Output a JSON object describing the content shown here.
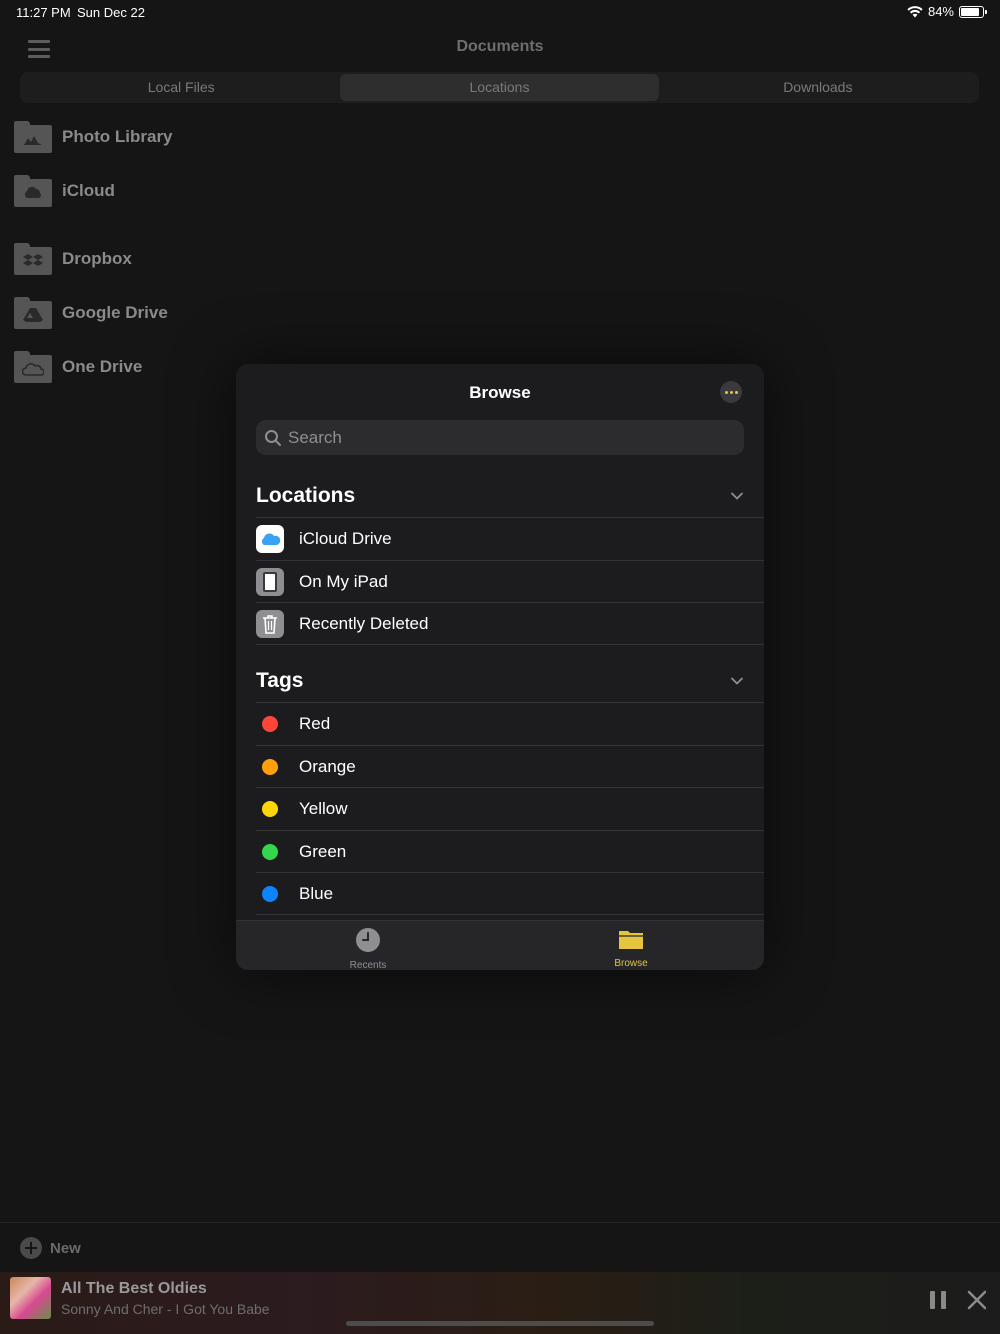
{
  "status_bar": {
    "time": "11:27 PM",
    "date": "Sun Dec 22",
    "battery": "84%",
    "battery_level": 0.84
  },
  "header": {
    "title": "Documents"
  },
  "segments": [
    {
      "label": "Local Files"
    },
    {
      "label": "Locations"
    },
    {
      "label": "Downloads"
    }
  ],
  "locations": [
    {
      "label": "Photo Library",
      "icon": "photo-icon"
    },
    {
      "label": "iCloud",
      "icon": "cloud-icon"
    },
    {
      "label": "Dropbox",
      "icon": "dropbox-icon"
    },
    {
      "label": "Google Drive",
      "icon": "google-drive-icon"
    },
    {
      "label": "One Drive",
      "icon": "onedrive-icon"
    }
  ],
  "new_button": {
    "label": "New"
  },
  "player": {
    "title": "All The Best Oldies",
    "subtitle": "Sonny And Cher - I Got You Babe"
  },
  "browse": {
    "title": "Browse",
    "search_placeholder": "Search",
    "locations_title": "Locations",
    "location_items": [
      {
        "label": "iCloud Drive",
        "icon": "icloud-drive-icon"
      },
      {
        "label": "On My iPad",
        "icon": "ipad-icon"
      },
      {
        "label": "Recently Deleted",
        "icon": "trash-icon"
      }
    ],
    "tags_title": "Tags",
    "tags": [
      {
        "label": "Red",
        "color": "#ff453a"
      },
      {
        "label": "Orange",
        "color": "#ff9f0a"
      },
      {
        "label": "Yellow",
        "color": "#ffd60a"
      },
      {
        "label": "Green",
        "color": "#32d74b"
      },
      {
        "label": "Blue",
        "color": "#0a84ff"
      }
    ],
    "tabs": [
      {
        "label": "Recents",
        "icon": "clock-icon"
      },
      {
        "label": "Browse",
        "icon": "folder-icon"
      }
    ],
    "accent_color": "#e5c43f"
  }
}
